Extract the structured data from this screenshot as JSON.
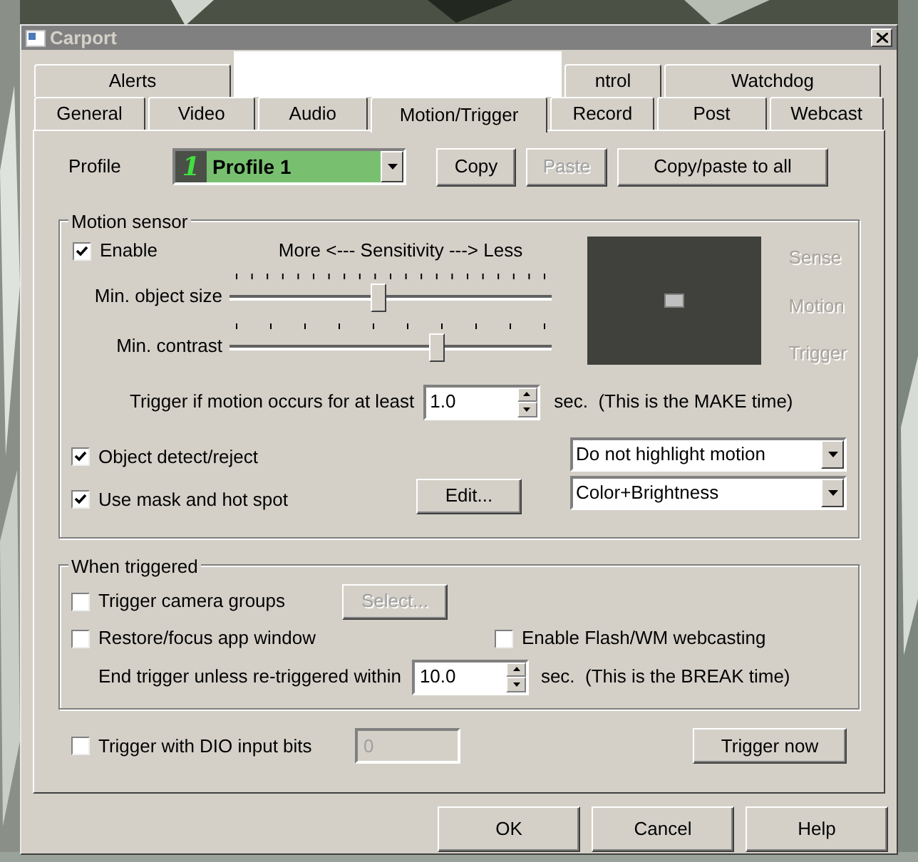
{
  "window": {
    "title": "Carport"
  },
  "tabs_top": [
    {
      "label": "Alerts",
      "selected": false
    },
    {
      "label": "ntrol",
      "selected": false
    },
    {
      "label": "Watchdog",
      "selected": false
    }
  ],
  "tabs_bottom": [
    {
      "label": "General",
      "selected": false
    },
    {
      "label": "Video",
      "selected": false
    },
    {
      "label": "Audio",
      "selected": false
    },
    {
      "label": "Motion/Trigger",
      "selected": true
    },
    {
      "label": "Record",
      "selected": false
    },
    {
      "label": "Post",
      "selected": false
    },
    {
      "label": "Webcast",
      "selected": false
    }
  ],
  "profile": {
    "label": "Profile",
    "badge": "1",
    "value": "Profile 1"
  },
  "profile_buttons": [
    {
      "label": "Copy",
      "disabled": false
    },
    {
      "label": "Paste",
      "disabled": true
    },
    {
      "label": "Copy/paste to all",
      "disabled": false
    }
  ],
  "motion_sensor": {
    "title": "Motion sensor",
    "enable": {
      "label": "Enable",
      "checked": true
    },
    "sensitivity_caption": "More <--- Sensitivity ---> Less",
    "sliders": [
      {
        "label": "Min. object size",
        "level": 0.46
      },
      {
        "label": "Min. contrast",
        "level": 0.65
      }
    ],
    "indicators": [
      {
        "label": "Sense",
        "active": false
      },
      {
        "label": "Motion",
        "active": false
      },
      {
        "label": "Trigger",
        "active": false
      }
    ],
    "make": {
      "label": "Trigger if motion occurs for at least",
      "value": "1.0",
      "suffix": "sec.  (This is the MAKE time)"
    },
    "object_detect": {
      "label": "Object detect/reject",
      "checked": true
    },
    "use_mask": {
      "label": "Use mask and hot spot",
      "checked": true
    },
    "edit_button": "Edit...",
    "highlight_select": "Do not highlight motion",
    "mode_select": "Color+Brightness"
  },
  "when_triggered": {
    "title": "When triggered",
    "camera_groups": {
      "label": "Trigger camera groups",
      "checked": false
    },
    "select_button": {
      "label": "Select...",
      "disabled": true
    },
    "restore": {
      "label": "Restore/focus app window",
      "checked": false
    },
    "webcasting": {
      "label": "Enable Flash/WM webcasting",
      "checked": false
    },
    "break": {
      "label": "End trigger unless re-triggered within",
      "value": "10.0",
      "suffix": "sec.  (This is the BREAK time)"
    }
  },
  "dio": {
    "label": "Trigger with DIO input bits",
    "checked": false,
    "value": "0",
    "disabled": true
  },
  "trigger_now": "Trigger now",
  "footer_buttons": [
    "OK",
    "Cancel",
    "Help"
  ]
}
